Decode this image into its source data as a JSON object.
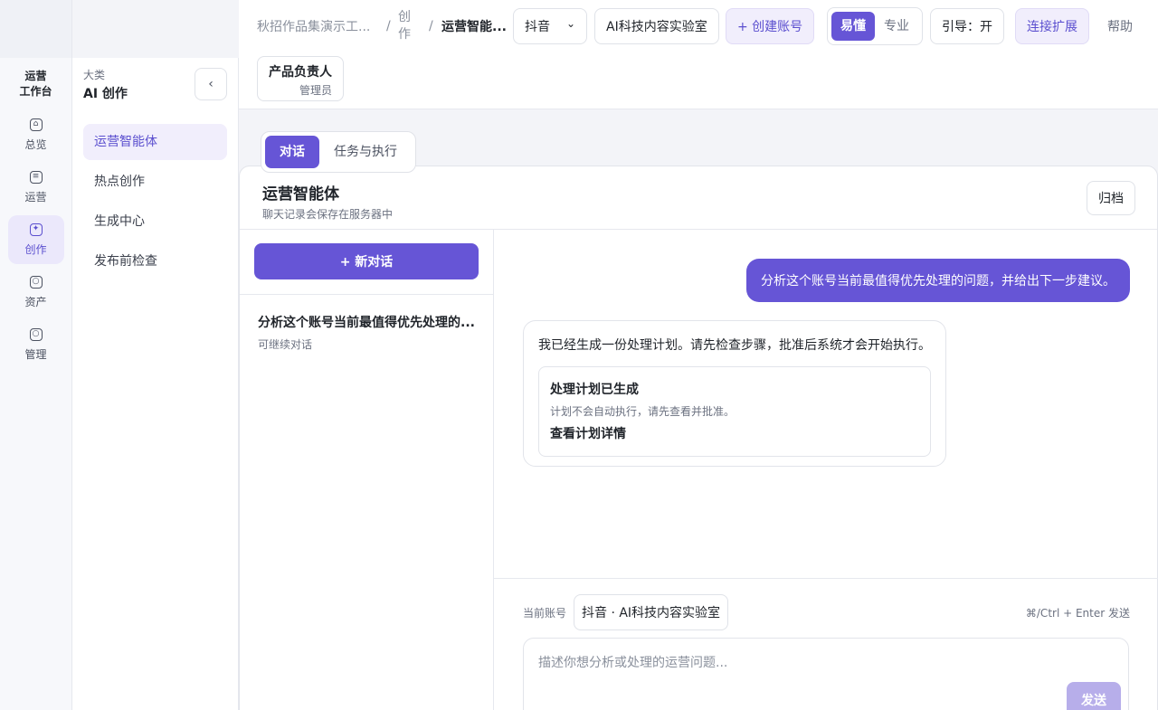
{
  "rail": {
    "title_line1": "运营",
    "title_line2": "工作台",
    "items": [
      {
        "label": "总览",
        "icon": "home-icon"
      },
      {
        "label": "运营",
        "icon": "list-icon"
      },
      {
        "label": "创作",
        "icon": "create-icon",
        "active": true
      },
      {
        "label": "资产",
        "icon": "asset-icon"
      },
      {
        "label": "管理",
        "icon": "manage-icon"
      }
    ]
  },
  "category": {
    "small_label": "大类",
    "big_label": "AI 创作",
    "collapse_glyph": "‹",
    "items": [
      {
        "label": "运营智能体",
        "active": true
      },
      {
        "label": "热点创作"
      },
      {
        "label": "生成中心"
      },
      {
        "label": "发布前检查"
      }
    ]
  },
  "topbar": {
    "crumb1": "秋招作品集演示工...",
    "sep1": "/",
    "crumb2_line1": "创",
    "crumb2_line2": "作",
    "sep2": "/",
    "crumb3": "运营智能...",
    "platform_select": "抖音",
    "platform_chevron": "⌄",
    "workspace": "AI科技内容实验室",
    "create_account": "+ 创建账号",
    "mode_easy": "易懂",
    "mode_pro": "专业",
    "guide": "引导：开",
    "connect_ext": "连接扩展",
    "help": "帮助",
    "user_name": "产品负责人",
    "user_role": "管理员"
  },
  "tabs": {
    "chat": "对话",
    "tasks": "任务与执行"
  },
  "card": {
    "title": "运营智能体",
    "subtitle": "聊天记录会保存在服务器中",
    "archive": "归档"
  },
  "convlist": {
    "new_button": "+ 新对话",
    "items": [
      {
        "title": "分析这个账号当前最值得优先处理的...",
        "sub": "可继续对话"
      }
    ]
  },
  "chat": {
    "user_message": "分析这个账号当前最值得优先处理的问题，并给出下一步建议。",
    "bot_message": "我已经生成一份处理计划。请先检查步骤，批准后系统才会开始执行。",
    "plan_title": "处理计划已生成",
    "plan_sub": "计划不会自动执行，请先查看并批准。",
    "plan_link": "查看计划详情"
  },
  "composer": {
    "account_label": "当前账号",
    "account_value": "抖音 · AI科技内容实验室",
    "shortcut": "⌘/Ctrl + Enter 发送",
    "placeholder": "描述你想分析或处理的运营问题...",
    "send": "发送"
  },
  "colors": {
    "accent": "#6655d6",
    "accent_soft": "#f1eefc",
    "send_disabled": "#b7aeea"
  }
}
